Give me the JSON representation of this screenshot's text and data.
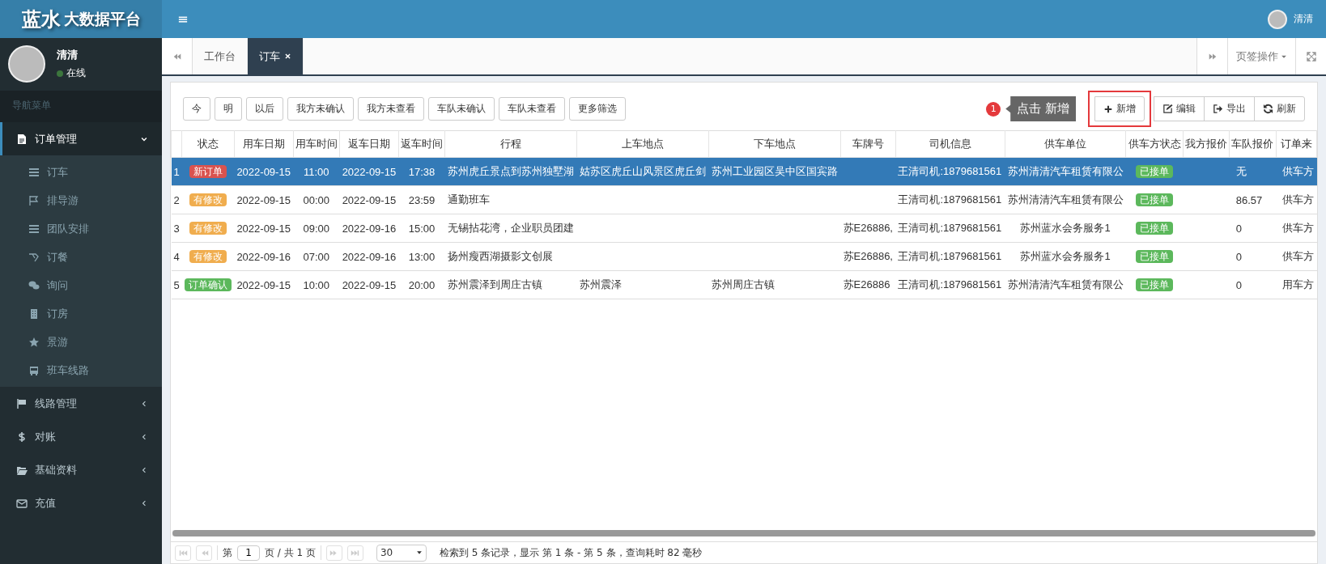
{
  "header": {
    "logo_main": "蓝水",
    "logo_sub": "大数据平台",
    "user_name": "清清"
  },
  "sidebar": {
    "user": {
      "name": "清清",
      "status": "在线"
    },
    "section_label": "导航菜单",
    "menu": [
      {
        "label": "订单管理",
        "expanded": true,
        "children": [
          {
            "label": "订车"
          },
          {
            "label": "排导游"
          },
          {
            "label": "团队安排"
          },
          {
            "label": "订餐"
          },
          {
            "label": "询问"
          },
          {
            "label": "订房"
          },
          {
            "label": "景游"
          },
          {
            "label": "班车线路"
          }
        ]
      },
      {
        "label": "线路管理",
        "expanded": false
      },
      {
        "label": "对账",
        "expanded": false
      },
      {
        "label": "基础资料",
        "expanded": false
      },
      {
        "label": "充值",
        "expanded": false
      }
    ]
  },
  "tabs": [
    {
      "label": "工作台",
      "selected": false
    },
    {
      "label": "订车",
      "selected": true
    }
  ],
  "tab_actions": {
    "label": "页签操作"
  },
  "filters": [
    "今",
    "明",
    "以后",
    "我方未确认",
    "我方未查看",
    "车队未确认",
    "车队未查看",
    "更多筛选"
  ],
  "hint": {
    "step": "1",
    "text": "点击 新增"
  },
  "actions": [
    {
      "label": "新增",
      "highlighted": true
    },
    {
      "label": "编辑",
      "highlighted": false
    },
    {
      "label": "导出",
      "highlighted": false
    },
    {
      "label": "刷新",
      "highlighted": false
    }
  ],
  "table": {
    "columns": [
      "状态",
      "用车日期",
      "用车时间",
      "返车日期",
      "返车时间",
      "行程",
      "上车地点",
      "下车地点",
      "车牌号",
      "司机信息",
      "供车单位",
      "供车方状态",
      "我方报价",
      "车队报价",
      "订单来"
    ],
    "rows": [
      {
        "selected": true,
        "no": "1",
        "status": {
          "text": "新订单",
          "color": "#d9534f"
        },
        "use_date": "2022-09-15",
        "use_time": "11:00",
        "return_date": "2022-09-15",
        "return_time": "17:38",
        "route": "苏州虎丘景点到苏州独墅湖",
        "pickup": "姑苏区虎丘山风景区虎丘剑",
        "dropoff": "苏州工业园区吴中区国宾路",
        "driver": "王清司机:1879681561",
        "supplier": "苏州清清汽车租赁有限公",
        "supplier_status": {
          "text": "已接单",
          "color": "#5cb85c"
        },
        "fleet_quote": "无",
        "order_source": "供车方"
      },
      {
        "selected": false,
        "no": "2",
        "status": {
          "text": "有修改",
          "color": "#f0ad4e"
        },
        "use_date": "2022-09-15",
        "use_time": "00:00",
        "return_date": "2022-09-15",
        "return_time": "23:59",
        "route": "通勤班车",
        "driver": "王清司机:1879681561",
        "supplier": "苏州清清汽车租赁有限公",
        "supplier_status": {
          "text": "已接单",
          "color": "#5cb85c"
        },
        "fleet_quote": "86.57",
        "order_source": "供车方"
      },
      {
        "selected": false,
        "no": "3",
        "status": {
          "text": "有修改",
          "color": "#f0ad4e"
        },
        "use_date": "2022-09-15",
        "use_time": "09:00",
        "return_date": "2022-09-16",
        "return_time": "15:00",
        "route": "无锡拈花湾，企业职员团建",
        "plate": "苏E26886,",
        "driver": "王清司机:1879681561",
        "supplier": "苏州蓝水会务服务1",
        "supplier_status": {
          "text": "已接单",
          "color": "#5cb85c"
        },
        "fleet_quote": "0",
        "order_source": "供车方"
      },
      {
        "selected": false,
        "no": "4",
        "status": {
          "text": "有修改",
          "color": "#f0ad4e"
        },
        "use_date": "2022-09-16",
        "use_time": "07:00",
        "return_date": "2022-09-16",
        "return_time": "13:00",
        "route": "扬州瘦西湖摄影文创展",
        "plate": "苏E26886,",
        "driver": "王清司机:1879681561",
        "supplier": "苏州蓝水会务服务1",
        "supplier_status": {
          "text": "已接单",
          "color": "#5cb85c"
        },
        "fleet_quote": "0",
        "order_source": "供车方"
      },
      {
        "selected": false,
        "no": "5",
        "status": {
          "text": "订单确认",
          "color": "#5cb85c"
        },
        "use_date": "2022-09-15",
        "use_time": "10:00",
        "return_date": "2022-09-15",
        "return_time": "20:00",
        "route": "苏州震泽到周庄古镇",
        "pickup": "苏州震泽",
        "dropoff": "苏州周庄古镇",
        "plate": "苏E26886",
        "driver": "王清司机:1879681561",
        "supplier": "苏州清清汽车租赁有限公",
        "supplier_status": {
          "text": "已接单",
          "color": "#5cb85c"
        },
        "fleet_quote": "0",
        "order_source": "用车方"
      }
    ]
  },
  "pager": {
    "page_prefix": "第",
    "page": "1",
    "page_suffix": "页 / 共 1 页",
    "page_size": "30",
    "summary": "检索到 5 条记录，显示 第 1 条 - 第 5 条，查询耗时 82 毫秒"
  }
}
